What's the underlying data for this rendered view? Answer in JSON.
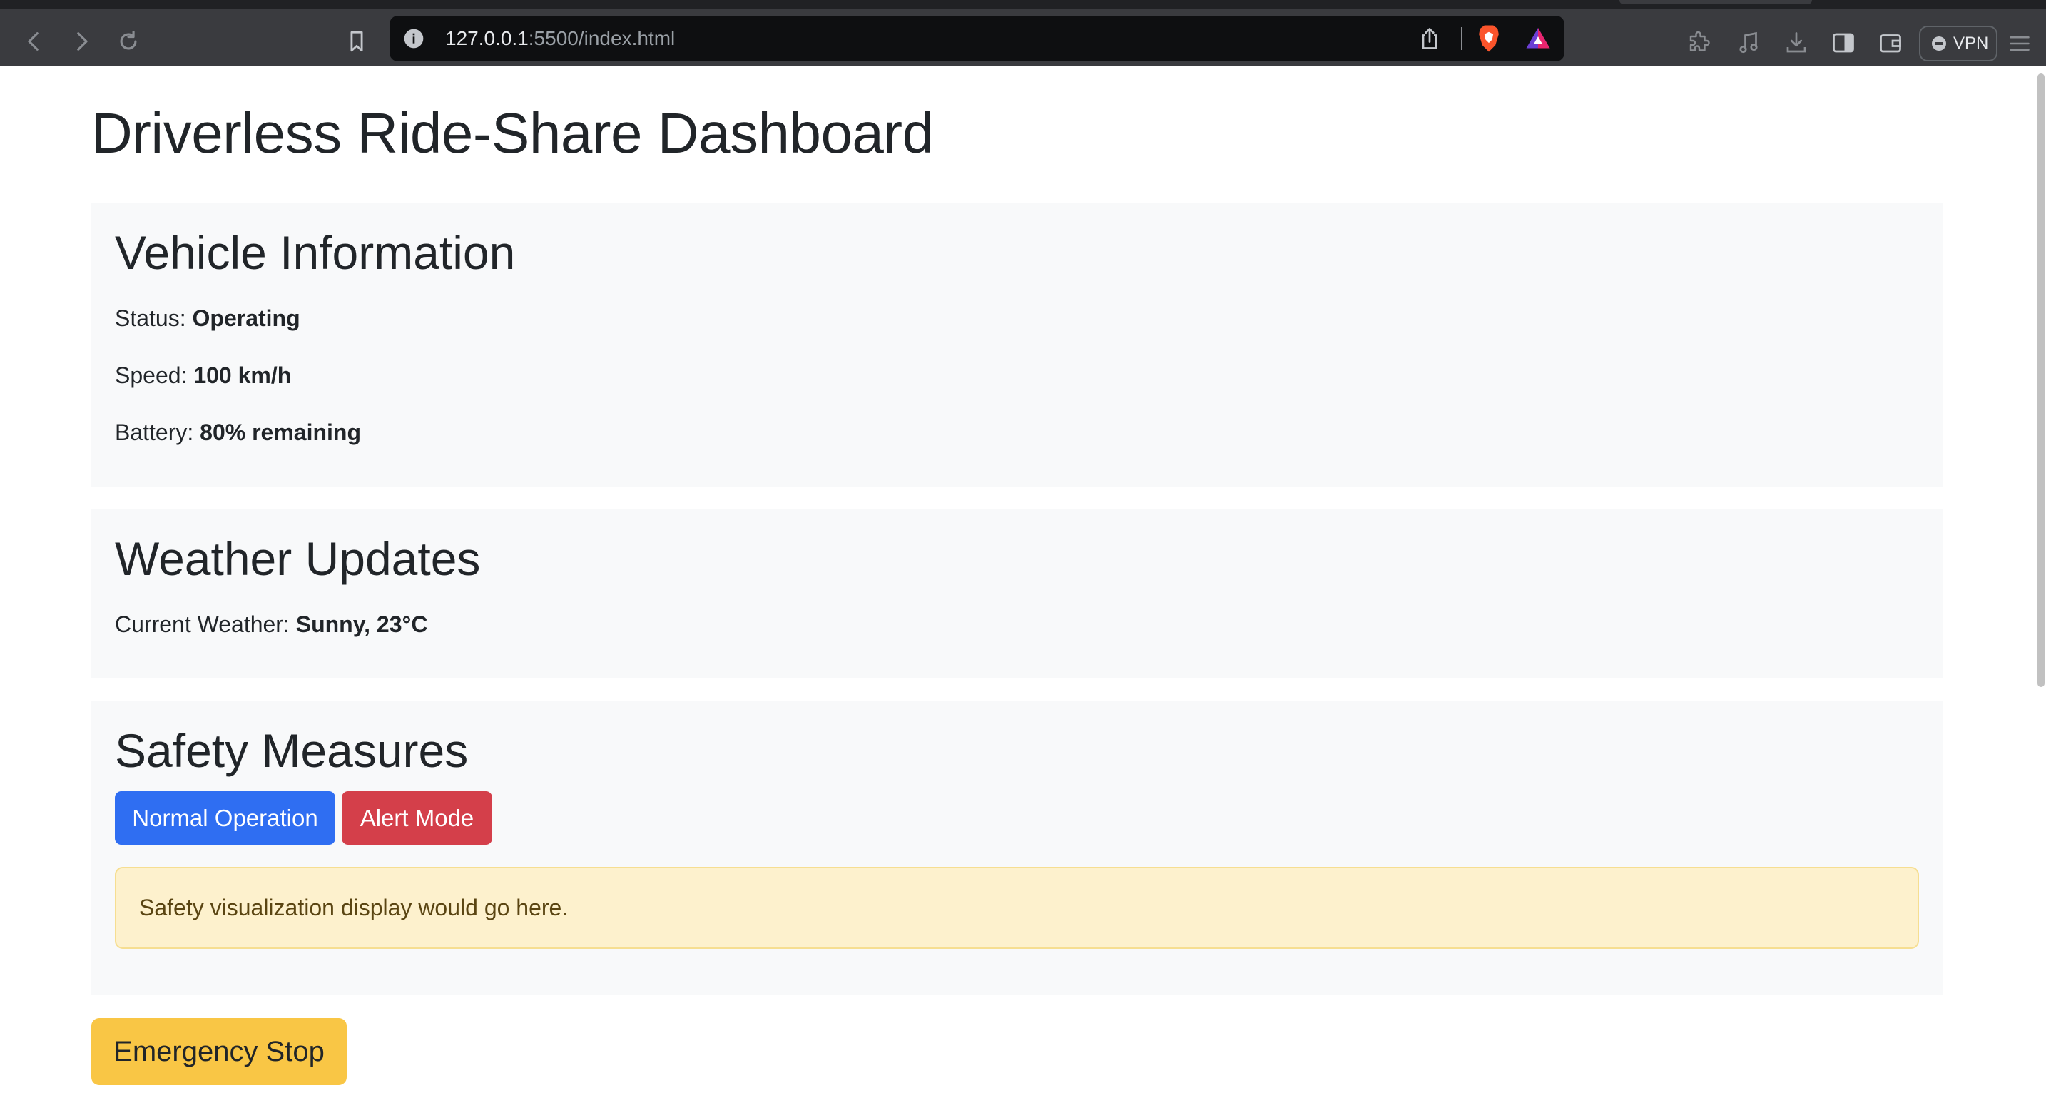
{
  "browser": {
    "url_host": "127.0.0.1",
    "url_path": ":5500/index.html",
    "vpn_label": "VPN"
  },
  "page": {
    "title": "Driverless Ride-Share Dashboard"
  },
  "vehicle": {
    "heading": "Vehicle Information",
    "status_label": "Status: ",
    "status_value": "Operating",
    "speed_label": "Speed: ",
    "speed_value": "100 km/h",
    "battery_label": "Battery: ",
    "battery_value": "80% remaining"
  },
  "weather": {
    "heading": "Weather Updates",
    "current_label": "Current Weather: ",
    "current_value": "Sunny, 23°C"
  },
  "safety": {
    "heading": "Safety Measures",
    "normal_button": "Normal Operation",
    "alert_button": "Alert Mode",
    "visualization_text": "Safety visualization display would go here."
  },
  "emergency": {
    "button_label": "Emergency Stop"
  },
  "colors": {
    "primary": "#2f6ef2",
    "danger": "#d43f4a",
    "warning": "#f9c645",
    "panel_bg": "#f8f9fa",
    "alert_bg": "#fdf1cd"
  }
}
